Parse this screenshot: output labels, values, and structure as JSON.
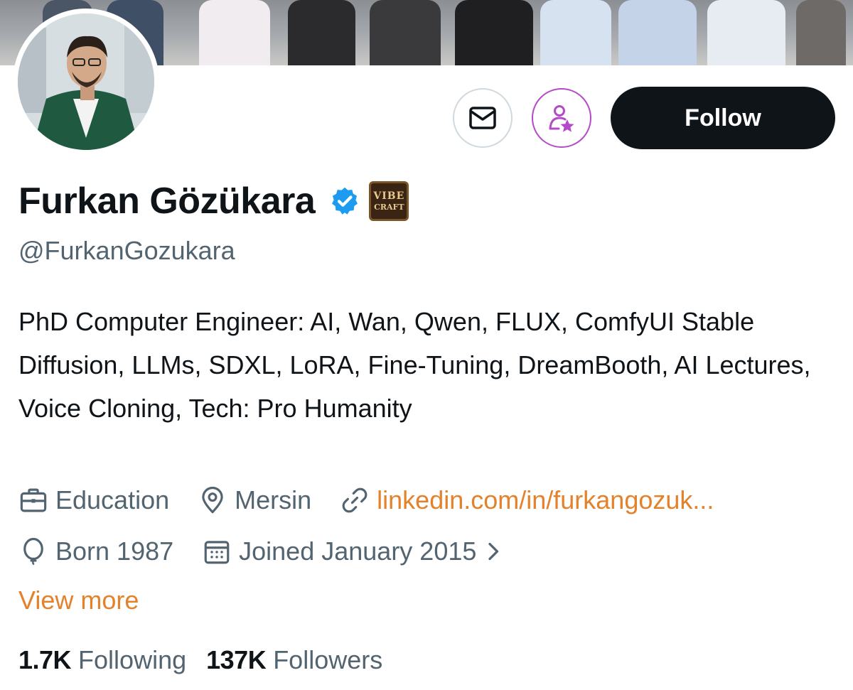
{
  "profile": {
    "display_name": "Furkan Gözükara",
    "verified_icon": "verified-badge-icon",
    "affiliate_badge": {
      "line1": "VIBE",
      "line2": "CRAFT"
    },
    "handle": "@FurkanGozukara",
    "bio": "PhD Computer Engineer: AI, Wan, Qwen, FLUX, ComfyUI Stable Diffusion, LLMs, SDXL, LoRA, Fine-Tuning, DreamBooth, AI Lectures, Voice Cloning, Tech: Pro Humanity",
    "category": "Education",
    "location": "Mersin",
    "website": "linkedin.com/in/furkangozuk...",
    "birth": "Born 1987",
    "joined": "Joined January 2015",
    "view_more": "View more"
  },
  "actions": {
    "message_icon": "envelope-icon",
    "subscribe_icon": "person-star-icon",
    "follow_label": "Follow"
  },
  "stats": {
    "following_count": "1.7K",
    "following_label": "Following",
    "followers_count": "137K",
    "followers_label": "Followers"
  },
  "colors": {
    "accent": "#e4822c",
    "text_primary": "#0f1419",
    "text_secondary": "#536471",
    "follow_bg": "#0f1419",
    "verified": "#1d9bf0",
    "subscribe_ring": "#b54ac9"
  }
}
